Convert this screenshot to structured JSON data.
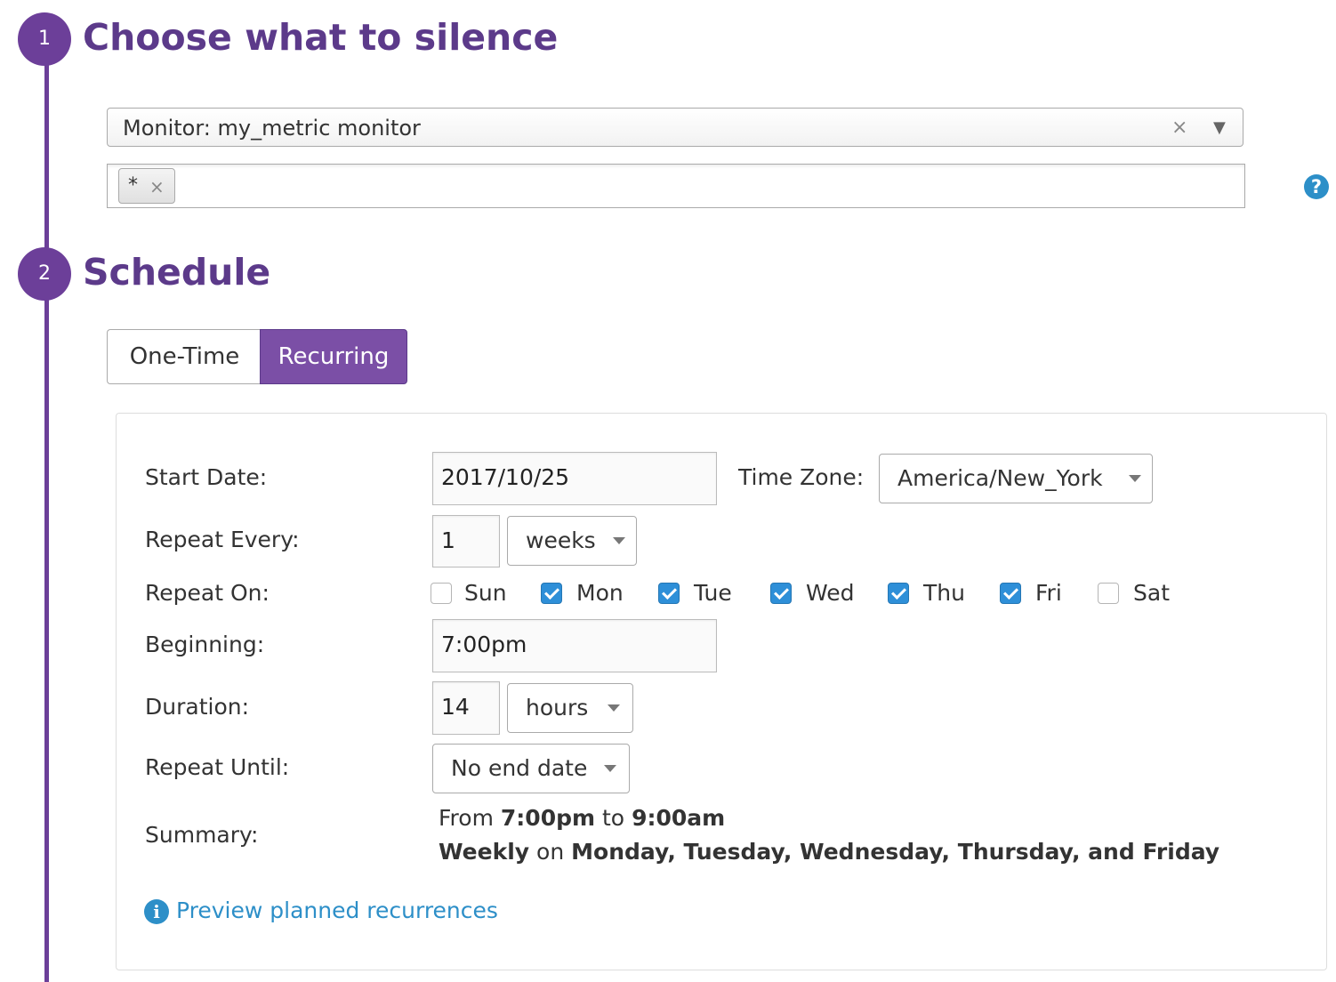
{
  "step1": {
    "number": "1",
    "title": "Choose what to silence"
  },
  "monitor_select": {
    "value": "Monitor: my_metric monitor",
    "clear_glyph": "×",
    "arrow_glyph": "▼"
  },
  "scope": {
    "tags": [
      {
        "label": "*",
        "remove_glyph": "×"
      }
    ],
    "help_glyph": "?"
  },
  "step2": {
    "number": "2",
    "title": "Schedule"
  },
  "schedule_tabs": {
    "one_time": "One-Time",
    "recurring": "Recurring",
    "active": "recurring"
  },
  "form": {
    "start_date": {
      "label": "Start Date:",
      "value": "2017/10/25"
    },
    "time_zone": {
      "label": "Time Zone:",
      "value": "America/New_York"
    },
    "repeat_every": {
      "label": "Repeat Every:",
      "value": "1",
      "unit": "weeks"
    },
    "repeat_on": {
      "label": "Repeat On:",
      "days": [
        {
          "label": "Sun",
          "checked": false
        },
        {
          "label": "Mon",
          "checked": true
        },
        {
          "label": "Tue",
          "checked": true
        },
        {
          "label": "Wed",
          "checked": true
        },
        {
          "label": "Thu",
          "checked": true
        },
        {
          "label": "Fri",
          "checked": true
        },
        {
          "label": "Sat",
          "checked": false
        }
      ]
    },
    "beginning": {
      "label": "Beginning:",
      "value": "7:00pm"
    },
    "duration": {
      "label": "Duration:",
      "value": "14",
      "unit": "hours"
    },
    "repeat_until": {
      "label": "Repeat Until:",
      "value": "No end date"
    },
    "summary": {
      "label": "Summary:",
      "from_word": "From",
      "start_time": "7:00pm",
      "to_word": "to",
      "end_time": "9:00am",
      "frequency": "Weekly",
      "on_word": "on",
      "days_text": "Monday, Tuesday, Wednesday, Thursday, and Friday"
    }
  },
  "preview_link": {
    "label": "Preview planned recurrences",
    "icon_glyph": "i"
  },
  "colors": {
    "accent": "#6c3f99",
    "title": "#5c3a8a",
    "link": "#2d8fc8",
    "checkbox": "#2e8fd8"
  }
}
